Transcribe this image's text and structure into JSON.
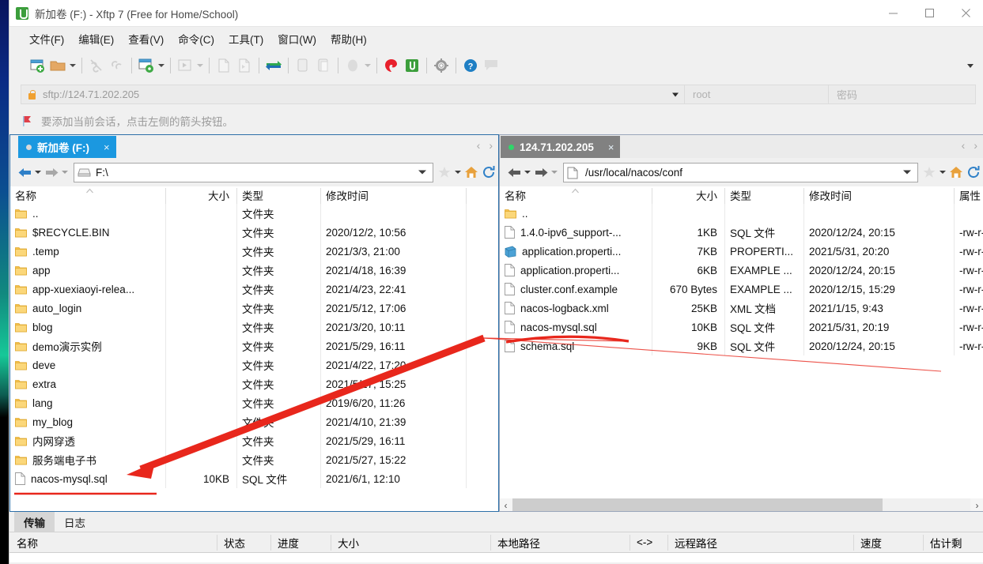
{
  "window": {
    "title": "新加卷 (F:) - Xftp 7 (Free for Home/School)",
    "app_icon": "xftp-icon",
    "minimize": "—",
    "maximize": "☐",
    "close": "✕"
  },
  "menubar": {
    "items": [
      {
        "label": "文件(F)",
        "name": "menu-file"
      },
      {
        "label": "编辑(E)",
        "name": "menu-edit"
      },
      {
        "label": "查看(V)",
        "name": "menu-view"
      },
      {
        "label": "命令(C)",
        "name": "menu-command"
      },
      {
        "label": "工具(T)",
        "name": "menu-tools"
      },
      {
        "label": "窗口(W)",
        "name": "menu-window"
      },
      {
        "label": "帮助(H)",
        "name": "menu-help"
      }
    ]
  },
  "toolbar": {
    "overflow_label": "▾"
  },
  "session_bar": {
    "url": "sftp://124.71.202.205",
    "user_placeholder": "root",
    "password_placeholder": "密码"
  },
  "hint": {
    "text": "要添加当前会话，点击左侧的箭头按钮。"
  },
  "left_pane": {
    "tab": {
      "label": "新加卷 (F:)",
      "close": "×",
      "status": "idle"
    },
    "tab_nav": {
      "prev": "‹",
      "next": "›"
    },
    "path": "F:\\",
    "columns": [
      "名称",
      "大小",
      "类型",
      "修改时间"
    ],
    "rows": [
      {
        "icon": "folder-icon",
        "name": "..",
        "size": "",
        "type": "文件夹",
        "modified": ""
      },
      {
        "icon": "folder-icon",
        "name": "$RECYCLE.BIN",
        "size": "",
        "type": "文件夹",
        "modified": "2020/12/2, 10:56"
      },
      {
        "icon": "folder-icon",
        "name": ".temp",
        "size": "",
        "type": "文件夹",
        "modified": "2021/3/3, 21:00"
      },
      {
        "icon": "folder-icon",
        "name": "app",
        "size": "",
        "type": "文件夹",
        "modified": "2021/4/18, 16:39"
      },
      {
        "icon": "folder-icon",
        "name": "app-xuexiaoyi-relea...",
        "size": "",
        "type": "文件夹",
        "modified": "2021/4/23, 22:41"
      },
      {
        "icon": "folder-icon",
        "name": "auto_login",
        "size": "",
        "type": "文件夹",
        "modified": "2021/5/12, 17:06"
      },
      {
        "icon": "folder-icon",
        "name": "blog",
        "size": "",
        "type": "文件夹",
        "modified": "2021/3/20, 10:11"
      },
      {
        "icon": "folder-icon",
        "name": "demo演示实例",
        "size": "",
        "type": "文件夹",
        "modified": "2021/5/29, 16:11"
      },
      {
        "icon": "folder-icon",
        "name": "deve",
        "size": "",
        "type": "文件夹",
        "modified": "2021/4/22, 17:20"
      },
      {
        "icon": "folder-icon",
        "name": "extra",
        "size": "",
        "type": "文件夹",
        "modified": "2021/5/27, 15:25"
      },
      {
        "icon": "folder-icon",
        "name": "lang",
        "size": "",
        "type": "文件夹",
        "modified": "2019/6/20, 11:26"
      },
      {
        "icon": "folder-icon",
        "name": "my_blog",
        "size": "",
        "type": "文件夹",
        "modified": "2021/4/10, 21:39"
      },
      {
        "icon": "folder-icon",
        "name": "内网穿透",
        "size": "",
        "type": "文件夹",
        "modified": "2021/5/29, 16:11"
      },
      {
        "icon": "folder-icon",
        "name": "服务端电子书",
        "size": "",
        "type": "文件夹",
        "modified": "2021/5/27, 15:22"
      },
      {
        "icon": "file-icon",
        "name": "nacos-mysql.sql",
        "size": "10KB",
        "type": "SQL 文件",
        "modified": "2021/6/1, 12:10"
      }
    ]
  },
  "right_pane": {
    "tab": {
      "label": "124.71.202.205",
      "close": "×",
      "status": "connected"
    },
    "tab_nav": {
      "prev": "‹",
      "next": "›"
    },
    "path": "/usr/local/nacos/conf",
    "columns": [
      "名称",
      "大小",
      "类型",
      "修改时间",
      "属性"
    ],
    "rows": [
      {
        "icon": "folder-icon",
        "name": "..",
        "size": "",
        "type": "",
        "modified": "",
        "attrs": ""
      },
      {
        "icon": "file-icon",
        "name": "1.4.0-ipv6_support-...",
        "size": "1KB",
        "type": "SQL 文件",
        "modified": "2020/12/24, 20:15",
        "attrs": "-rw-r-"
      },
      {
        "icon": "properties-icon",
        "name": "application.properti...",
        "size": "7KB",
        "type": "PROPERTI...",
        "modified": "2021/5/31, 20:20",
        "attrs": "-rw-r-"
      },
      {
        "icon": "file-icon",
        "name": "application.properti...",
        "size": "6KB",
        "type": "EXAMPLE ...",
        "modified": "2020/12/24, 20:15",
        "attrs": "-rw-r-"
      },
      {
        "icon": "file-icon",
        "name": "cluster.conf.example",
        "size": "670 Bytes",
        "type": "EXAMPLE ...",
        "modified": "2020/12/15, 15:29",
        "attrs": "-rw-r-"
      },
      {
        "icon": "file-icon",
        "name": "nacos-logback.xml",
        "size": "25KB",
        "type": "XML 文档",
        "modified": "2021/1/15, 9:43",
        "attrs": "-rw-r-"
      },
      {
        "icon": "file-icon",
        "name": "nacos-mysql.sql",
        "size": "10KB",
        "type": "SQL 文件",
        "modified": "2021/5/31, 20:19",
        "attrs": "-rw-r-"
      },
      {
        "icon": "file-icon",
        "name": "schema.sql",
        "size": "9KB",
        "type": "SQL 文件",
        "modified": "2020/12/24, 20:15",
        "attrs": "-rw-r-"
      }
    ],
    "hscroll": {
      "left": "‹",
      "right": "›"
    }
  },
  "bottom_panel": {
    "tabs": [
      {
        "label": "传输",
        "name": "tab-transfer",
        "active": true
      },
      {
        "label": "日志",
        "name": "tab-log",
        "active": false
      }
    ],
    "columns": [
      "名称",
      "状态",
      "进度",
      "大小",
      "本地路径",
      "<->",
      "远程路径",
      "速度",
      "估计剩"
    ]
  },
  "colors": {
    "accent_tab": "#1b98e0",
    "inactive_tab": "#818181",
    "annotation_red": "#e8271c",
    "connected_dot": "#2fd66a",
    "folder": "#fcd577"
  }
}
